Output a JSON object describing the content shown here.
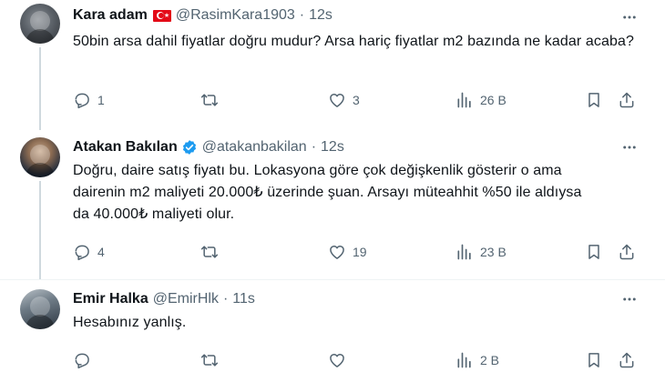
{
  "tweets": [
    {
      "name": "Kara adam",
      "handle": "@RasimKara1903",
      "dot": "·",
      "time": "12s",
      "text": "50bin arsa dahil fiyatlar doğru mudur? Arsa hariç fiyatlar m2 bazında ne kadar acaba?",
      "replies": "1",
      "reposts": "",
      "likes": "3",
      "views": "26 B"
    },
    {
      "name": "Atakan Bakılan",
      "handle": "@atakanbakilan",
      "dot": "·",
      "time": "12s",
      "text": "Doğru, daire satış fiyatı bu. Lokasyona göre çok değişkenlik gösterir o ama dairenin m2 maliyeti 20.000₺ üzerinde şuan. Arsayı müteahhit %50 ile aldıysa da 40.000₺ maliyeti olur.",
      "replies": "4",
      "reposts": "",
      "likes": "19",
      "views": "23 B"
    },
    {
      "name": "Emir Halka",
      "handle": "@EmirHlk",
      "dot": "·",
      "time": "11s",
      "text": "Hesabınız yanlış.",
      "replies": "",
      "reposts": "",
      "likes": "",
      "views": "2 B"
    }
  ],
  "icons": {
    "flag": "turkey-flag-icon",
    "verified": "verified-badge-icon",
    "more": "more-options-icon",
    "reply": "reply-icon",
    "repost": "repost-icon",
    "like": "like-icon",
    "views": "views-icon",
    "bookmark": "bookmark-icon",
    "share": "share-icon"
  },
  "colors": {
    "text": "#0f1419",
    "muted": "#536471",
    "verified": "#1d9bf0",
    "flag": "#e30a17",
    "separator": "#eff3f4",
    "thread_line": "#cfd9de"
  }
}
